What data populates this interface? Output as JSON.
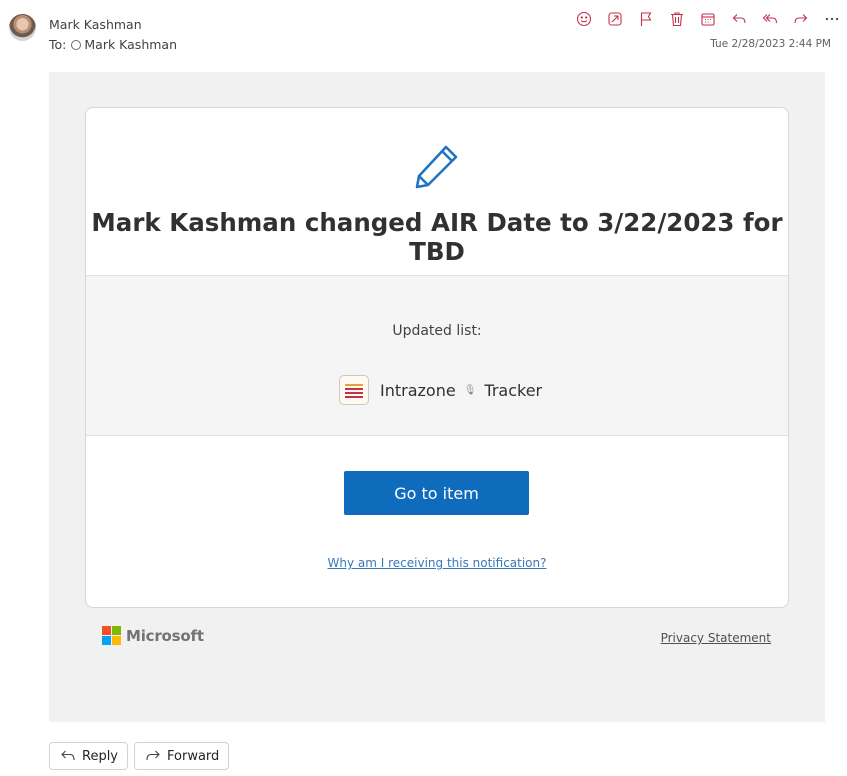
{
  "header": {
    "sender": "Mark Kashman",
    "to_label": "To:",
    "recipient": "Mark Kashman",
    "timestamp": "Tue 2/28/2023 2:44 PM"
  },
  "toolbar": {
    "icons": [
      "emoji-icon",
      "immersive-reader-icon",
      "flag-icon",
      "delete-icon",
      "calendar-icon",
      "reply-icon",
      "reply-all-icon",
      "forward-icon",
      "more-icon"
    ]
  },
  "notification": {
    "headline": "Mark Kashman changed AIR Date to 3/22/2023 for TBD",
    "updated_label": "Updated list:",
    "list_name_part1": "Intrazone",
    "list_name_part2": "Tracker",
    "goto_label": "Go to item",
    "why_link": "Why am I receiving this notification?"
  },
  "footer": {
    "brand": "Microsoft",
    "privacy_link": "Privacy Statement"
  },
  "actions": {
    "reply_label": "Reply",
    "forward_label": "Forward"
  },
  "colors": {
    "accent": "#0f6cbd",
    "toolbar_icon": "#c4314b",
    "ms_red": "#f25022",
    "ms_green": "#7fba00",
    "ms_blue": "#00a4ef",
    "ms_yellow": "#ffb900"
  }
}
